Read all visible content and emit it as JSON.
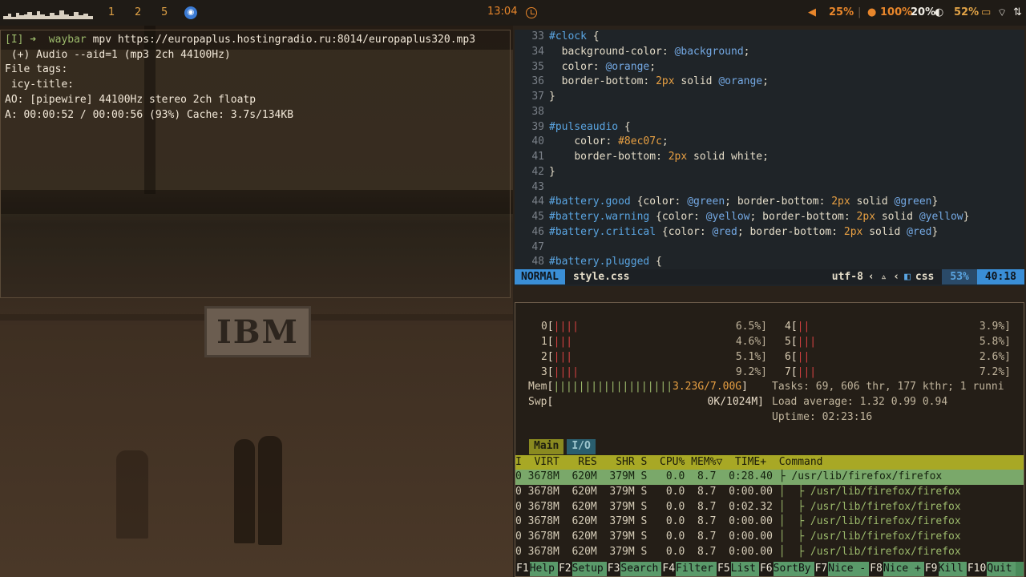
{
  "topbar": {
    "workspaces": [
      "1",
      "2",
      "5"
    ],
    "clock": "13:04",
    "volume": "25%",
    "mic": "100%",
    "brightness": "20%",
    "battery": "52%"
  },
  "mpv": {
    "prompt_prefix": "[I] ➜",
    "command_dir": "waybar",
    "command": "mpv https://europaplus.hostingradio.ru:8014/europaplus320.mp3",
    "lines": [
      " (+) Audio --aid=1 (mp3 2ch 44100Hz)",
      "File tags:",
      " icy-title:",
      "AO: [pipewire] 44100Hz stereo 2ch floatp",
      "A: 00:00:52 / 00:00:56 (93%) Cache: 3.7s/134KB"
    ]
  },
  "editor": {
    "mode": "NORMAL",
    "filename": "style.css",
    "encoding": "utf-8",
    "filetype": "css",
    "percent": "53%",
    "position": "40:18",
    "lines": [
      {
        "n": "33",
        "text": "#clock {"
      },
      {
        "n": "34",
        "text": "  background-color: @background;"
      },
      {
        "n": "35",
        "text": "  color: @orange;"
      },
      {
        "n": "36",
        "text": "  border-bottom: 2px solid @orange;"
      },
      {
        "n": "37",
        "text": "}"
      },
      {
        "n": "38",
        "text": ""
      },
      {
        "n": "39",
        "text": "#pulseaudio {"
      },
      {
        "n": "40",
        "text": "    color: #8ec07c;"
      },
      {
        "n": "41",
        "text": "    border-bottom: 2px solid white;"
      },
      {
        "n": "42",
        "text": "}"
      },
      {
        "n": "43",
        "text": ""
      },
      {
        "n": "44",
        "text": "#battery.good {color: @green; border-bottom: 2px solid @green}"
      },
      {
        "n": "45",
        "text": "#battery.warning {color: @yellow; border-bottom: 2px solid @yellow}"
      },
      {
        "n": "46",
        "text": "#battery.critical {color: @red; border-bottom: 2px solid @red}"
      },
      {
        "n": "47",
        "text": ""
      },
      {
        "n": "48",
        "text": "#battery.plugged {"
      }
    ]
  },
  "htop": {
    "cpus": [
      {
        "id": "0",
        "bars": "||||",
        "pct": "6.5%"
      },
      {
        "id": "1",
        "bars": "|||",
        "pct": "4.6%"
      },
      {
        "id": "2",
        "bars": "|||",
        "pct": "5.1%"
      },
      {
        "id": "3",
        "bars": "||||",
        "pct": "9.2%"
      },
      {
        "id": "4",
        "bars": "||",
        "pct": "3.9%"
      },
      {
        "id": "5",
        "bars": "|||",
        "pct": "5.8%"
      },
      {
        "id": "6",
        "bars": "||",
        "pct": "2.6%"
      },
      {
        "id": "7",
        "bars": "|||",
        "pct": "7.2%"
      }
    ],
    "mem_label": "Mem",
    "mem_bars": "|||||||||||||||||||",
    "mem_value": "3.23G/7.00G",
    "swp_label": "Swp",
    "swp_value": "0K/1024M",
    "tasks": "Tasks: 69, 606 thr, 177 kthr; 1 runni",
    "load": "Load average: 1.32 0.99 0.94",
    "uptime": "Uptime: 02:23:16",
    "tab_main": "Main",
    "tab_io": "I/O",
    "header": "I  VIRT   RES   SHR S  CPU% MEM%▽  TIME+  Command",
    "rows": [
      {
        "cols": "0 3678M  620M  379M S   0.0  8.7  0:28.40",
        "cmd": " ├ /usr/lib/firefox/firefox"
      },
      {
        "cols": "0 3678M  620M  379M S   0.0  8.7  0:00.00",
        "cmd": " │  ├ /usr/lib/firefox/firefox"
      },
      {
        "cols": "0 3678M  620M  379M S   0.0  8.7  0:02.32",
        "cmd": " │  ├ /usr/lib/firefox/firefox"
      },
      {
        "cols": "0 3678M  620M  379M S   0.0  8.7  0:00.00",
        "cmd": " │  ├ /usr/lib/firefox/firefox"
      },
      {
        "cols": "0 3678M  620M  379M S   0.0  8.7  0:00.00",
        "cmd": " │  ├ /usr/lib/firefox/firefox"
      },
      {
        "cols": "0 3678M  620M  379M S   0.0  8.7  0:00.00",
        "cmd": " │  ├ /usr/lib/firefox/firefox"
      }
    ],
    "fkeys": [
      {
        "k": "F1",
        "l": "Help"
      },
      {
        "k": "F2",
        "l": "Setup"
      },
      {
        "k": "F3",
        "l": "Search"
      },
      {
        "k": "F4",
        "l": "Filter"
      },
      {
        "k": "F5",
        "l": "List"
      },
      {
        "k": "F6",
        "l": "SortBy"
      },
      {
        "k": "F7",
        "l": "Nice -"
      },
      {
        "k": "F8",
        "l": "Nice +"
      },
      {
        "k": "F9",
        "l": "Kill"
      },
      {
        "k": "F10",
        "l": "Quit"
      }
    ]
  },
  "wallpaper": {
    "sign_text": "IBM"
  }
}
